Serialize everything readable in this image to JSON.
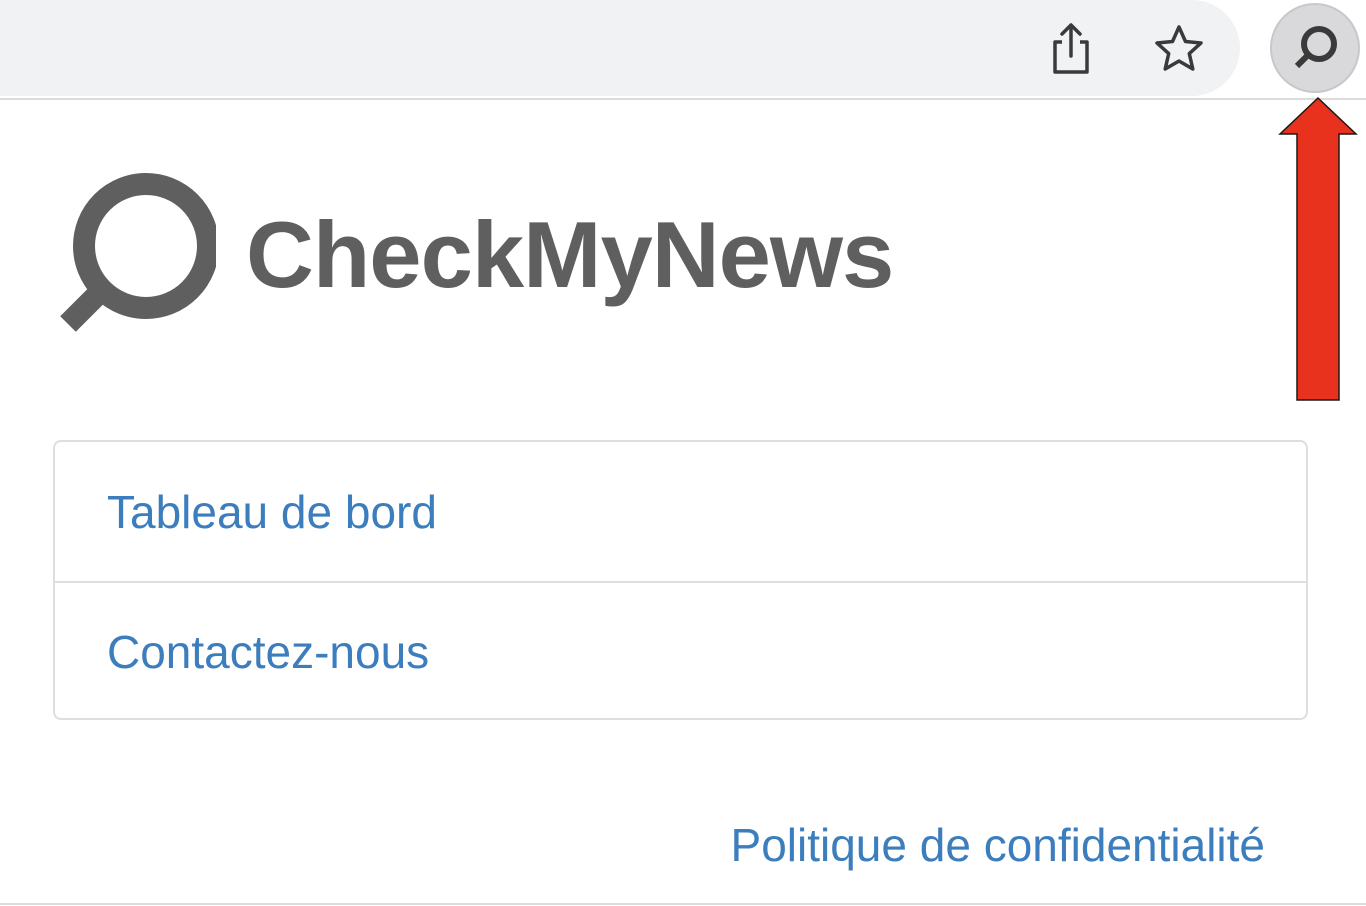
{
  "toolbar": {
    "share_icon": "share-icon",
    "star_icon": "star-icon",
    "extension_icon": "magnifier-icon"
  },
  "annotation": {
    "arrow_color": "#e8321e"
  },
  "header": {
    "brand_name": "CheckMyNews"
  },
  "menu": {
    "items": [
      {
        "label": "Tableau de bord"
      },
      {
        "label": "Contactez-nous"
      }
    ]
  },
  "footer": {
    "privacy_link": "Politique de confidentialité"
  },
  "colors": {
    "link": "#3c7dbd",
    "brand_text": "#5f5f5f",
    "border": "#dedede"
  }
}
